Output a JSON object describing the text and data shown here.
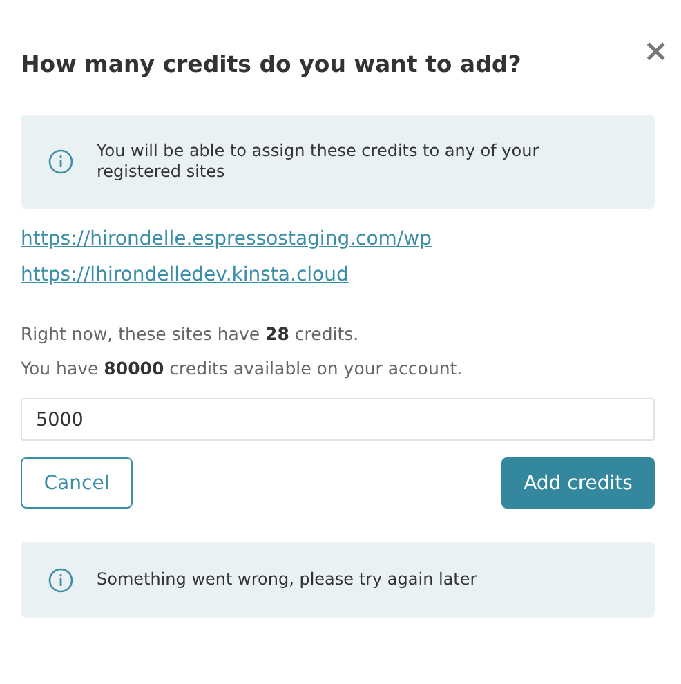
{
  "dialog": {
    "title": "How many credits do you want to add?",
    "close": "×"
  },
  "info_notice": {
    "text": "You will be able to assign these credits to any of your registered sites"
  },
  "sites": [
    {
      "url": "https://hirondelle.espressostaging.com/wp"
    },
    {
      "url": "https://lhirondelledev.kinsta.cloud"
    }
  ],
  "summary": [
    "Right now, these sites have **28** credits.",
    "You have **80000** credits available on your account."
  ],
  "credits_field": {
    "value": "5000"
  },
  "buttons": [
    {
      "label": "Cancel",
      "kind": "secondary"
    },
    {
      "label": "Add credits",
      "kind": "primary"
    }
  ],
  "error_notice": {
    "text": "Something went wrong, please try again later"
  }
}
